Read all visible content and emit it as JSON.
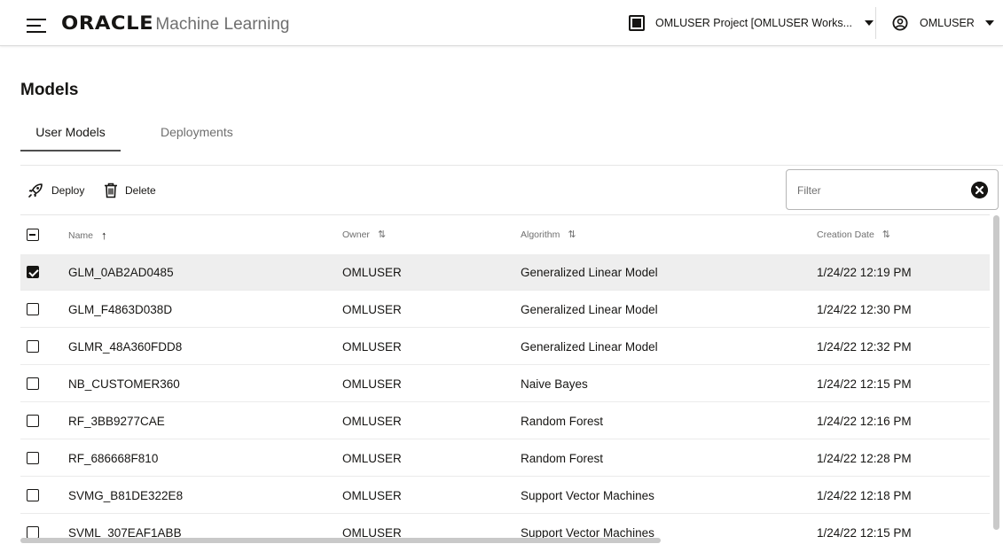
{
  "header": {
    "brand": "ORACLE",
    "product": "Machine Learning",
    "project_label": "OMLUSER Project [OMLUSER Works...",
    "user_label": "OMLUSER"
  },
  "page": {
    "title": "Models",
    "tabs": [
      {
        "label": "User Models",
        "active": true
      },
      {
        "label": "Deployments",
        "active": false
      }
    ]
  },
  "toolbar": {
    "deploy_label": "Deploy",
    "delete_label": "Delete",
    "filter_placeholder": "Filter"
  },
  "table": {
    "columns": [
      {
        "label": "Name",
        "sort": "↑"
      },
      {
        "label": "Owner",
        "sort": "⇅"
      },
      {
        "label": "Algorithm",
        "sort": "⇅"
      },
      {
        "label": "Creation Date",
        "sort": "⇅"
      }
    ],
    "rows": [
      {
        "name": "GLM_0AB2AD0485",
        "owner": "OMLUSER",
        "algorithm": "Generalized Linear Model",
        "date": "1/24/22 12:19 PM",
        "checked": true
      },
      {
        "name": "GLM_F4863D038D",
        "owner": "OMLUSER",
        "algorithm": "Generalized Linear Model",
        "date": "1/24/22 12:30 PM",
        "checked": false
      },
      {
        "name": "GLMR_48A360FDD8",
        "owner": "OMLUSER",
        "algorithm": "Generalized Linear Model",
        "date": "1/24/22 12:32 PM",
        "checked": false
      },
      {
        "name": "NB_CUSTOMER360",
        "owner": "OMLUSER",
        "algorithm": "Naive Bayes",
        "date": "1/24/22 12:15 PM",
        "checked": false
      },
      {
        "name": "RF_3BB9277CAE",
        "owner": "OMLUSER",
        "algorithm": "Random Forest",
        "date": "1/24/22 12:16 PM",
        "checked": false
      },
      {
        "name": "RF_686668F810",
        "owner": "OMLUSER",
        "algorithm": "Random Forest",
        "date": "1/24/22 12:28 PM",
        "checked": false
      },
      {
        "name": "SVMG_B81DE322E8",
        "owner": "OMLUSER",
        "algorithm": "Support Vector Machines",
        "date": "1/24/22 12:18 PM",
        "checked": false
      },
      {
        "name": "SVML_307EAF1ABB",
        "owner": "OMLUSER",
        "algorithm": "Support Vector Machines",
        "date": "1/24/22 12:15 PM",
        "checked": false
      }
    ]
  },
  "icons": {
    "menu": "hamburger-menu-icon",
    "project": "grid-project-icon",
    "user": "user-circle-icon",
    "deploy": "rocket-deploy-icon",
    "delete": "trash-icon",
    "clear": "clear-filter-icon"
  },
  "colors": {
    "text": "#161513",
    "muted": "#6f6f6f",
    "selected_row": "#eeeeee",
    "border": "#dcdcdc"
  }
}
